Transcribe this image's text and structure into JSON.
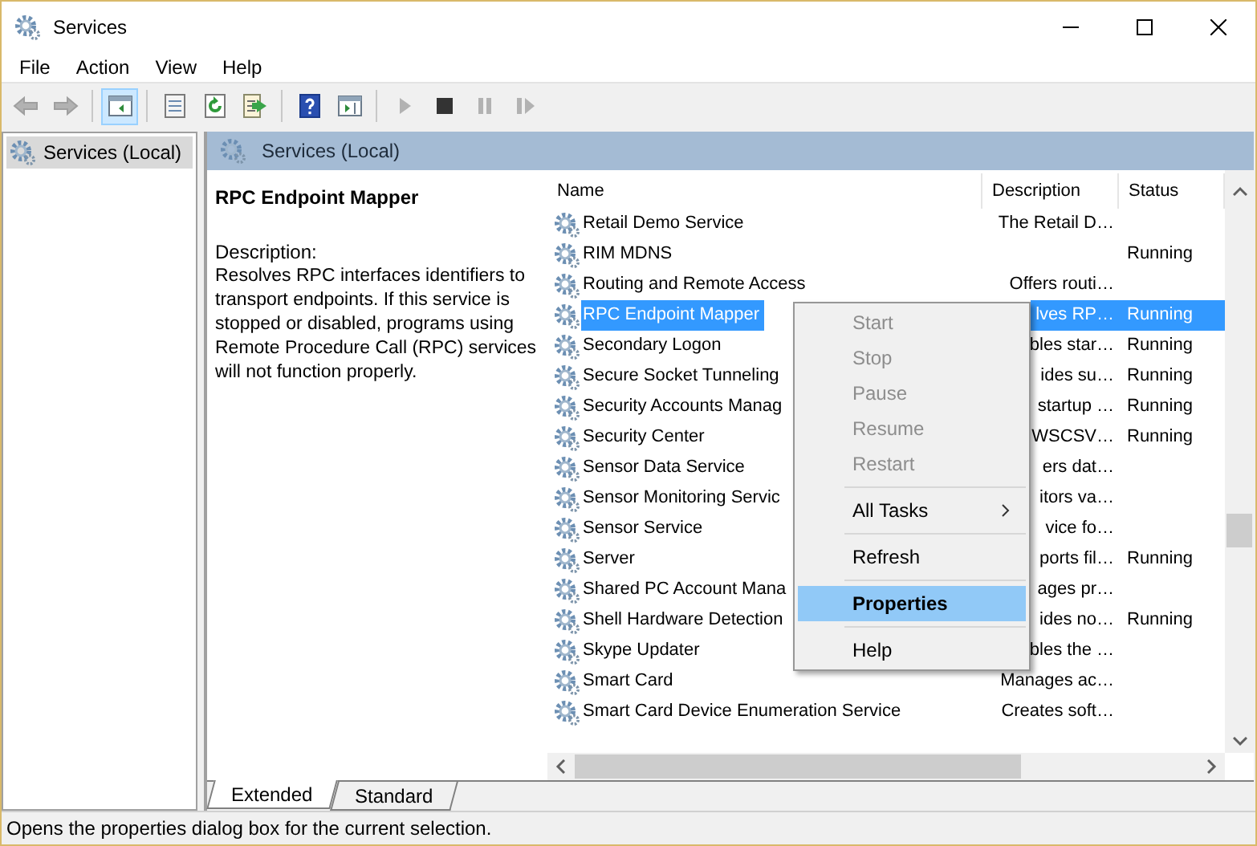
{
  "window": {
    "title": "Services"
  },
  "menu": [
    "File",
    "Action",
    "View",
    "Help"
  ],
  "toolbar": [
    {
      "kind": "back",
      "disabled": true,
      "selected": false
    },
    {
      "kind": "forward",
      "disabled": true,
      "selected": false
    },
    {
      "kind": "tree",
      "disabled": false,
      "selected": true
    },
    {
      "kind": "properties",
      "disabled": false,
      "selected": false
    },
    {
      "kind": "refresh",
      "disabled": false,
      "selected": false
    },
    {
      "kind": "export",
      "disabled": false,
      "selected": false
    },
    {
      "kind": "help",
      "disabled": false,
      "selected": false
    },
    {
      "kind": "actionpane",
      "disabled": false,
      "selected": false
    },
    {
      "kind": "start",
      "disabled": true,
      "selected": false
    },
    {
      "kind": "stop",
      "disabled": false,
      "selected": false
    },
    {
      "kind": "pause",
      "disabled": true,
      "selected": false
    },
    {
      "kind": "restart",
      "disabled": true,
      "selected": false
    }
  ],
  "tree": [
    {
      "label": "Services (Local)",
      "selected": true
    }
  ],
  "panel": {
    "title": "Services (Local)",
    "service_name": "RPC Endpoint Mapper",
    "description_label": "Description:",
    "description": "Resolves RPC interfaces identifiers to transport endpoints. If this service is stopped or disabled, programs using Remote Procedure Call (RPC) services will not function properly."
  },
  "table": {
    "columns": [
      "Name",
      "Description",
      "Status"
    ],
    "rows": [
      {
        "name": "Retail Demo Service",
        "description": "The Retail D…",
        "status": "",
        "selected": false
      },
      {
        "name": "RIM MDNS",
        "description": "",
        "status": "Running",
        "selected": false
      },
      {
        "name": "Routing and Remote Access",
        "description": "Offers routi…",
        "status": "",
        "selected": false
      },
      {
        "name": "RPC Endpoint Mapper",
        "description": "lves RP…",
        "status": "Running",
        "selected": true
      },
      {
        "name": "Secondary Logon",
        "description": "bles star…",
        "status": "Running",
        "selected": false
      },
      {
        "name": "Secure Socket Tunneling",
        "description": "ides su…",
        "status": "Running",
        "selected": false
      },
      {
        "name": "Security Accounts Manag",
        "description": "startup …",
        "status": "Running",
        "selected": false
      },
      {
        "name": "Security Center",
        "description": "WSCSV…",
        "status": "Running",
        "selected": false
      },
      {
        "name": "Sensor Data Service",
        "description": "ers dat…",
        "status": "",
        "selected": false
      },
      {
        "name": "Sensor Monitoring Servic",
        "description": "itors va…",
        "status": "",
        "selected": false
      },
      {
        "name": "Sensor Service",
        "description": "vice fo…",
        "status": "",
        "selected": false
      },
      {
        "name": "Server",
        "description": "ports fil…",
        "status": "Running",
        "selected": false
      },
      {
        "name": "Shared PC Account Mana",
        "description": "ages pr…",
        "status": "",
        "selected": false
      },
      {
        "name": "Shell Hardware Detection",
        "description": "ides no…",
        "status": "Running",
        "selected": false
      },
      {
        "name": "Skype Updater",
        "description": "bles the …",
        "status": "",
        "selected": false
      },
      {
        "name": "Smart Card",
        "description": "Manages ac…",
        "status": "",
        "selected": false
      },
      {
        "name": "Smart Card Device Enumeration Service",
        "description": "Creates soft…",
        "status": "",
        "selected": false
      }
    ]
  },
  "context_menu": [
    {
      "kind": "item",
      "label": "Start",
      "disabled": true,
      "selected": false,
      "default": false,
      "submenu": false
    },
    {
      "kind": "item",
      "label": "Stop",
      "disabled": true,
      "selected": false,
      "default": false,
      "submenu": false
    },
    {
      "kind": "item",
      "label": "Pause",
      "disabled": true,
      "selected": false,
      "default": false,
      "submenu": false
    },
    {
      "kind": "item",
      "label": "Resume",
      "disabled": true,
      "selected": false,
      "default": false,
      "submenu": false
    },
    {
      "kind": "item",
      "label": "Restart",
      "disabled": true,
      "selected": false,
      "default": false,
      "submenu": false
    },
    {
      "kind": "separator"
    },
    {
      "kind": "item",
      "label": "All Tasks",
      "disabled": false,
      "selected": false,
      "default": false,
      "submenu": true
    },
    {
      "kind": "separator"
    },
    {
      "kind": "item",
      "label": "Refresh",
      "disabled": false,
      "selected": false,
      "default": false,
      "submenu": false
    },
    {
      "kind": "separator"
    },
    {
      "kind": "item",
      "label": "Properties",
      "disabled": false,
      "selected": true,
      "default": true,
      "submenu": false
    },
    {
      "kind": "separator"
    },
    {
      "kind": "item",
      "label": "Help",
      "disabled": false,
      "selected": false,
      "default": false,
      "submenu": false
    }
  ],
  "tabs": [
    {
      "label": "Extended",
      "selected": true
    },
    {
      "label": "Standard",
      "selected": false
    }
  ],
  "status_bar": "Opens the properties dialog box for the current selection."
}
